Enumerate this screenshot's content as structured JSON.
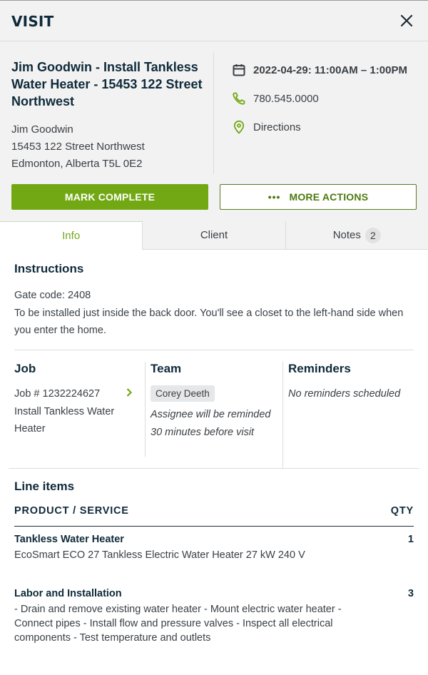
{
  "header": {
    "title": "VISIT",
    "close_icon": "close-icon"
  },
  "summary": {
    "visit_title": "Jim Goodwin - Install Tankless Water Heater - 15453 122 Street Northwest",
    "client_name": "Jim Goodwin",
    "street": "15453 122 Street Northwest",
    "city_line": "Edmonton, Alberta T5L 0E2",
    "schedule": "2022-04-29: 11:00AM – 1:00PM",
    "phone": "780.545.0000",
    "directions_label": "Directions",
    "icons": {
      "schedule": "calendar-icon",
      "phone": "phone-icon",
      "directions": "map-pin-icon"
    }
  },
  "actions": {
    "mark_complete": "MARK COMPLETE",
    "more_actions_dots": "•••",
    "more_actions": "MORE ACTIONS"
  },
  "tabs": [
    {
      "label": "Info",
      "active": true
    },
    {
      "label": "Client",
      "active": false
    },
    {
      "label": "Notes",
      "badge": "2",
      "active": false
    }
  ],
  "instructions": {
    "heading": "Instructions",
    "line1": "Gate code: 2408",
    "line2": "To be installed just inside the back door. You'll see a closet to the left-hand side when you enter the home."
  },
  "job": {
    "heading": "Job",
    "number": "Job # 1232224627",
    "title": "Install Tankless Water Heater"
  },
  "team": {
    "heading": "Team",
    "assignee": "Corey Deeth",
    "reminder_note": "Assignee will be reminded 30 minutes before visit"
  },
  "reminders": {
    "heading": "Reminders",
    "empty_text": "No reminders scheduled"
  },
  "line_items": {
    "heading": "Line items",
    "col_product": "PRODUCT / SERVICE",
    "col_qty": "QTY",
    "items": [
      {
        "name": "Tankless Water Heater",
        "qty": "1",
        "description": "EcoSmart ECO 27 Tankless Electric Water Heater 27 kW 240 V"
      },
      {
        "name": "Labor and Installation",
        "qty": "3",
        "description": "- Drain and remove existing water heater - Mount electric water heater - Connect pipes - Install flow and pressure valves - Inspect all electrical components - Test temperature and outlets"
      }
    ]
  },
  "colors": {
    "accent_green": "#72a814",
    "dark_green": "#4d7a10",
    "heading_navy": "#0f2a3a"
  }
}
